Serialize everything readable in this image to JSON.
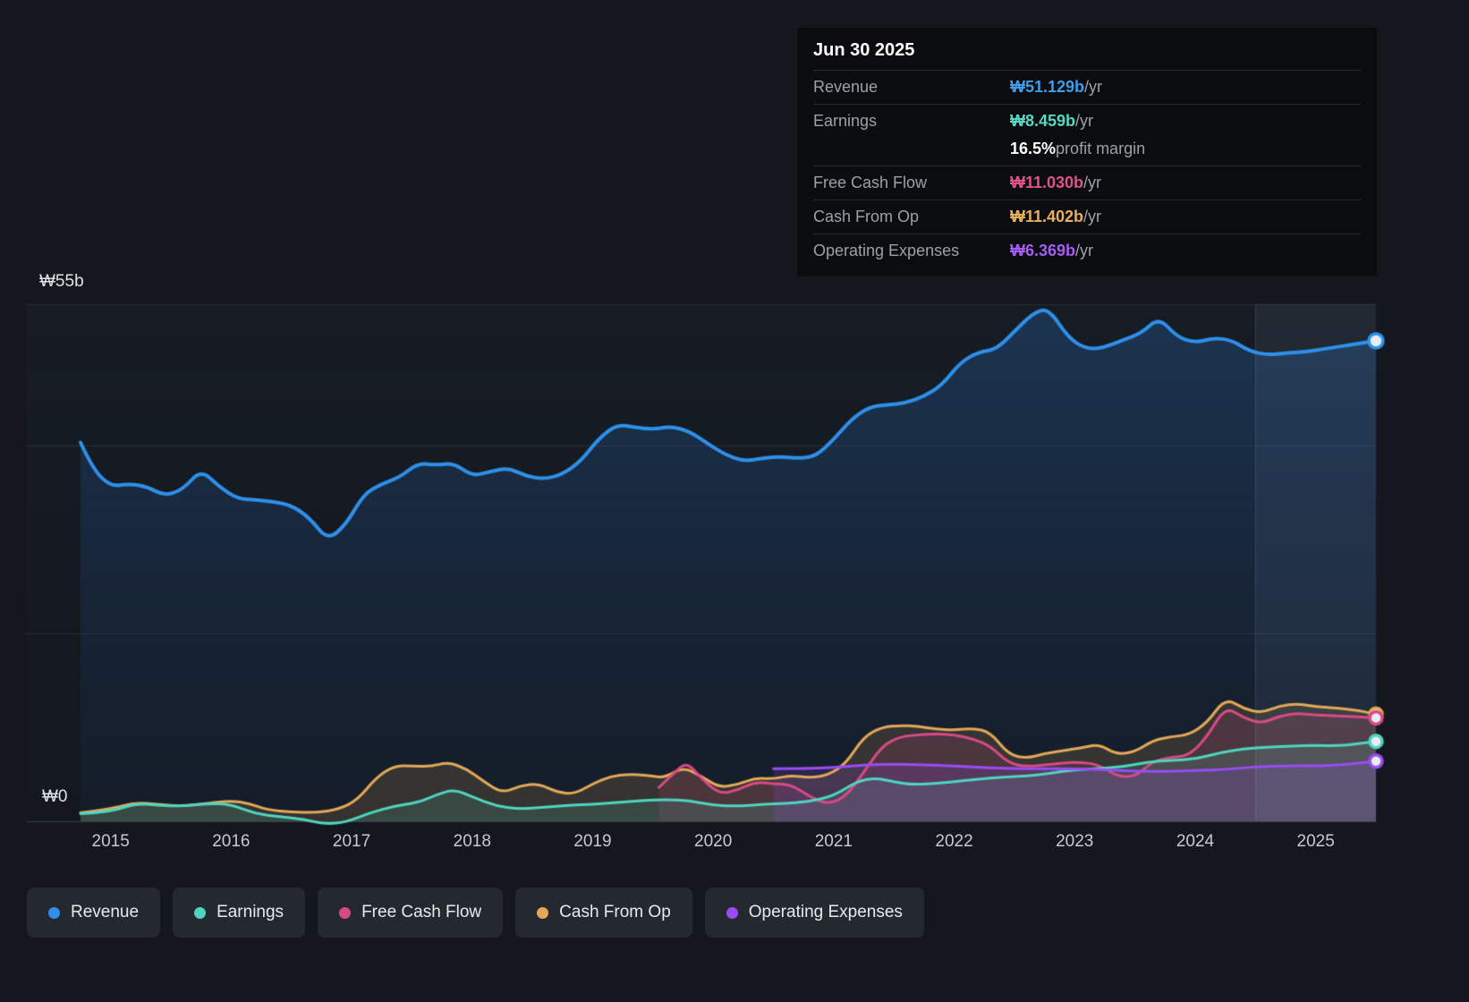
{
  "tooltip": {
    "date": "Jun 30 2025",
    "revenue": {
      "label": "Revenue",
      "value": "₩51.129b",
      "unit": " /yr",
      "color": "#3f9ceb"
    },
    "earnings": {
      "label": "Earnings",
      "value": "₩8.459b",
      "unit": " /yr",
      "color": "#56d8c5"
    },
    "margin": {
      "value": "16.5%",
      "text": " profit margin"
    },
    "fcf": {
      "label": "Free Cash Flow",
      "value": "₩11.030b",
      "unit": " /yr",
      "color": "#e0518e"
    },
    "cashop": {
      "label": "Cash From Op",
      "value": "₩11.402b",
      "unit": " /yr",
      "color": "#e7b05e"
    },
    "opex": {
      "label": "Operating Expenses",
      "value": "₩6.369b",
      "unit": " /yr",
      "color": "#a55cf5"
    }
  },
  "axis": {
    "y_top_label": "₩55b",
    "y_zero_label": "₩0",
    "years": [
      "2015",
      "2016",
      "2017",
      "2018",
      "2019",
      "2020",
      "2021",
      "2022",
      "2023",
      "2024",
      "2025"
    ]
  },
  "legend": {
    "items": [
      {
        "label": "Revenue",
        "color": "#2e90ea"
      },
      {
        "label": "Earnings",
        "color": "#4fd5bf"
      },
      {
        "label": "Free Cash Flow",
        "color": "#d84a85"
      },
      {
        "label": "Cash From Op",
        "color": "#e2a858"
      },
      {
        "label": "Operating Expenses",
        "color": "#9a4cf2"
      }
    ]
  },
  "chart_data": {
    "type": "area",
    "title": "Financial history: revenue, earnings, cash flows and operating expenses (₩ billions)",
    "x_domain": [
      2014.75,
      2025.5
    ],
    "ylim": [
      0,
      55
    ],
    "y_gridlines": [
      0,
      20,
      40,
      55
    ],
    "x_ticks": [
      2015,
      2016,
      2017,
      2018,
      2019,
      2020,
      2021,
      2022,
      2023,
      2024,
      2025
    ],
    "highlight_band": {
      "start": 2024.5,
      "end": 2025.5
    },
    "series": [
      {
        "name": "Revenue",
        "color": "#2e90ea",
        "line_width": 4,
        "fill_top": "rgba(40,110,185,0.30)",
        "fill_bottom": "rgba(30,70,130,0.10)",
        "fill": "rgba(40,110,185,0.22)",
        "points": [
          [
            2014.75,
            40.3
          ],
          [
            2014.85,
            37.5
          ],
          [
            2015.0,
            35.6
          ],
          [
            2015.15,
            35.9
          ],
          [
            2015.3,
            35.6
          ],
          [
            2015.45,
            34.6
          ],
          [
            2015.6,
            35.3
          ],
          [
            2015.75,
            37.4
          ],
          [
            2015.9,
            35.6
          ],
          [
            2016.05,
            34.3
          ],
          [
            2016.2,
            34.2
          ],
          [
            2016.35,
            34.0
          ],
          [
            2016.5,
            33.6
          ],
          [
            2016.65,
            32.3
          ],
          [
            2016.8,
            29.9
          ],
          [
            2016.95,
            31.5
          ],
          [
            2017.1,
            34.8
          ],
          [
            2017.25,
            35.9
          ],
          [
            2017.4,
            36.6
          ],
          [
            2017.55,
            38.1
          ],
          [
            2017.7,
            37.9
          ],
          [
            2017.85,
            38.1
          ],
          [
            2018.0,
            36.7
          ],
          [
            2018.15,
            37.2
          ],
          [
            2018.3,
            37.6
          ],
          [
            2018.45,
            36.7
          ],
          [
            2018.6,
            36.4
          ],
          [
            2018.75,
            36.9
          ],
          [
            2018.9,
            38.3
          ],
          [
            2019.05,
            40.7
          ],
          [
            2019.2,
            42.2
          ],
          [
            2019.35,
            41.9
          ],
          [
            2019.5,
            41.7
          ],
          [
            2019.65,
            42.0
          ],
          [
            2019.8,
            41.5
          ],
          [
            2019.95,
            40.2
          ],
          [
            2020.1,
            39.0
          ],
          [
            2020.25,
            38.3
          ],
          [
            2020.4,
            38.6
          ],
          [
            2020.55,
            38.8
          ],
          [
            2020.7,
            38.6
          ],
          [
            2020.85,
            38.8
          ],
          [
            2021.0,
            40.6
          ],
          [
            2021.15,
            42.8
          ],
          [
            2021.3,
            44.1
          ],
          [
            2021.45,
            44.3
          ],
          [
            2021.6,
            44.5
          ],
          [
            2021.75,
            45.2
          ],
          [
            2021.9,
            46.4
          ],
          [
            2022.05,
            48.8
          ],
          [
            2022.2,
            49.9
          ],
          [
            2022.35,
            50.2
          ],
          [
            2022.5,
            52.1
          ],
          [
            2022.65,
            54.0
          ],
          [
            2022.78,
            54.6
          ],
          [
            2022.95,
            51.4
          ],
          [
            2023.1,
            50.2
          ],
          [
            2023.25,
            50.4
          ],
          [
            2023.4,
            51.2
          ],
          [
            2023.55,
            51.9
          ],
          [
            2023.7,
            53.6
          ],
          [
            2023.85,
            51.5
          ],
          [
            2024.0,
            50.9
          ],
          [
            2024.15,
            51.4
          ],
          [
            2024.3,
            51.2
          ],
          [
            2024.45,
            50.0
          ],
          [
            2024.6,
            49.6
          ],
          [
            2024.75,
            49.8
          ],
          [
            2024.9,
            49.9
          ],
          [
            2025.05,
            50.2
          ],
          [
            2025.2,
            50.5
          ],
          [
            2025.35,
            50.8
          ],
          [
            2025.5,
            51.1
          ]
        ]
      },
      {
        "name": "Cash From Op",
        "color": "#e2a858",
        "line_width": 3,
        "fill": "rgba(226,168,88,0.16)",
        "points": [
          [
            2014.75,
            0.9
          ],
          [
            2015.0,
            1.3
          ],
          [
            2015.2,
            2.0
          ],
          [
            2015.4,
            1.8
          ],
          [
            2015.6,
            1.6
          ],
          [
            2015.8,
            1.9
          ],
          [
            2016.0,
            2.2
          ],
          [
            2016.15,
            1.9
          ],
          [
            2016.3,
            1.2
          ],
          [
            2016.5,
            1.0
          ],
          [
            2016.7,
            0.9
          ],
          [
            2016.9,
            1.3
          ],
          [
            2017.05,
            2.3
          ],
          [
            2017.2,
            4.6
          ],
          [
            2017.35,
            5.9
          ],
          [
            2017.5,
            5.9
          ],
          [
            2017.65,
            5.8
          ],
          [
            2017.8,
            6.3
          ],
          [
            2017.95,
            5.6
          ],
          [
            2018.1,
            4.2
          ],
          [
            2018.25,
            3.0
          ],
          [
            2018.4,
            3.8
          ],
          [
            2018.55,
            4.0
          ],
          [
            2018.7,
            3.1
          ],
          [
            2018.85,
            2.9
          ],
          [
            2019.0,
            4.0
          ],
          [
            2019.15,
            4.8
          ],
          [
            2019.3,
            5.0
          ],
          [
            2019.45,
            4.9
          ],
          [
            2019.6,
            4.6
          ],
          [
            2019.75,
            5.8
          ],
          [
            2019.9,
            4.8
          ],
          [
            2020.05,
            3.6
          ],
          [
            2020.2,
            3.9
          ],
          [
            2020.35,
            4.6
          ],
          [
            2020.5,
            4.5
          ],
          [
            2020.65,
            4.9
          ],
          [
            2020.8,
            4.6
          ],
          [
            2020.95,
            4.9
          ],
          [
            2021.1,
            6.1
          ],
          [
            2021.25,
            9.0
          ],
          [
            2021.4,
            10.0
          ],
          [
            2021.55,
            10.2
          ],
          [
            2021.7,
            10.1
          ],
          [
            2021.85,
            9.8
          ],
          [
            2022.0,
            9.7
          ],
          [
            2022.15,
            9.9
          ],
          [
            2022.3,
            9.5
          ],
          [
            2022.45,
            7.1
          ],
          [
            2022.6,
            6.7
          ],
          [
            2022.75,
            7.2
          ],
          [
            2022.9,
            7.5
          ],
          [
            2023.05,
            7.8
          ],
          [
            2023.2,
            8.2
          ],
          [
            2023.35,
            7.1
          ],
          [
            2023.5,
            7.4
          ],
          [
            2023.65,
            8.6
          ],
          [
            2023.8,
            9.0
          ],
          [
            2023.95,
            9.2
          ],
          [
            2024.1,
            10.5
          ],
          [
            2024.25,
            13.1
          ],
          [
            2024.4,
            12.0
          ],
          [
            2024.55,
            11.5
          ],
          [
            2024.7,
            12.3
          ],
          [
            2024.85,
            12.5
          ],
          [
            2025.0,
            12.2
          ],
          [
            2025.2,
            12.0
          ],
          [
            2025.35,
            11.8
          ],
          [
            2025.5,
            11.4
          ]
        ]
      },
      {
        "name": "Free Cash Flow",
        "color": "#d84a85",
        "line_width": 3,
        "fill": "rgba(214,73,132,0.14)",
        "points": [
          [
            2019.55,
            3.6
          ],
          [
            2019.68,
            5.2
          ],
          [
            2019.78,
            6.3
          ],
          [
            2019.9,
            4.6
          ],
          [
            2020.05,
            2.9
          ],
          [
            2020.2,
            3.3
          ],
          [
            2020.35,
            4.2
          ],
          [
            2020.5,
            4.0
          ],
          [
            2020.65,
            3.9
          ],
          [
            2020.8,
            2.6
          ],
          [
            2020.95,
            1.8
          ],
          [
            2021.1,
            2.6
          ],
          [
            2021.25,
            5.2
          ],
          [
            2021.4,
            8.0
          ],
          [
            2021.55,
            9.0
          ],
          [
            2021.7,
            9.2
          ],
          [
            2021.85,
            9.3
          ],
          [
            2022.0,
            9.2
          ],
          [
            2022.15,
            8.8
          ],
          [
            2022.3,
            8.0
          ],
          [
            2022.45,
            6.2
          ],
          [
            2022.6,
            5.8
          ],
          [
            2022.75,
            6.0
          ],
          [
            2022.9,
            6.2
          ],
          [
            2023.05,
            6.3
          ],
          [
            2023.2,
            6.0
          ],
          [
            2023.35,
            4.8
          ],
          [
            2023.5,
            4.7
          ],
          [
            2023.65,
            6.4
          ],
          [
            2023.8,
            6.8
          ],
          [
            2023.95,
            7.0
          ],
          [
            2024.1,
            9.0
          ],
          [
            2024.25,
            12.2
          ],
          [
            2024.4,
            11.0
          ],
          [
            2024.55,
            10.4
          ],
          [
            2024.7,
            11.2
          ],
          [
            2024.85,
            11.5
          ],
          [
            2025.0,
            11.3
          ],
          [
            2025.2,
            11.2
          ],
          [
            2025.5,
            11.0
          ]
        ]
      },
      {
        "name": "Earnings",
        "color": "#4fd5bf",
        "line_width": 3,
        "fill": "rgba(80,212,190,0.14)",
        "points": [
          [
            2014.75,
            0.8
          ],
          [
            2015.0,
            1.0
          ],
          [
            2015.2,
            1.9
          ],
          [
            2015.4,
            1.7
          ],
          [
            2015.6,
            1.6
          ],
          [
            2015.8,
            1.9
          ],
          [
            2016.0,
            1.8
          ],
          [
            2016.2,
            0.8
          ],
          [
            2016.4,
            0.5
          ],
          [
            2016.6,
            0.2
          ],
          [
            2016.78,
            -0.3
          ],
          [
            2016.95,
            -0.1
          ],
          [
            2017.15,
            0.9
          ],
          [
            2017.35,
            1.6
          ],
          [
            2017.55,
            2.0
          ],
          [
            2017.7,
            2.8
          ],
          [
            2017.85,
            3.4
          ],
          [
            2018.0,
            2.6
          ],
          [
            2018.2,
            1.6
          ],
          [
            2018.4,
            1.3
          ],
          [
            2018.6,
            1.5
          ],
          [
            2018.8,
            1.7
          ],
          [
            2019.0,
            1.8
          ],
          [
            2019.2,
            2.0
          ],
          [
            2019.4,
            2.2
          ],
          [
            2019.6,
            2.3
          ],
          [
            2019.8,
            2.2
          ],
          [
            2020.0,
            1.7
          ],
          [
            2020.2,
            1.6
          ],
          [
            2020.4,
            1.8
          ],
          [
            2020.6,
            1.9
          ],
          [
            2020.8,
            2.1
          ],
          [
            2021.0,
            2.7
          ],
          [
            2021.2,
            4.3
          ],
          [
            2021.35,
            4.6
          ],
          [
            2021.5,
            4.2
          ],
          [
            2021.65,
            3.9
          ],
          [
            2021.8,
            4.0
          ],
          [
            2022.0,
            4.2
          ],
          [
            2022.2,
            4.5
          ],
          [
            2022.4,
            4.7
          ],
          [
            2022.6,
            4.8
          ],
          [
            2022.8,
            5.1
          ],
          [
            2023.0,
            5.5
          ],
          [
            2023.2,
            5.6
          ],
          [
            2023.4,
            5.8
          ],
          [
            2023.6,
            6.3
          ],
          [
            2023.8,
            6.5
          ],
          [
            2024.0,
            6.6
          ],
          [
            2024.2,
            7.3
          ],
          [
            2024.4,
            7.7
          ],
          [
            2024.6,
            7.9
          ],
          [
            2024.8,
            8.0
          ],
          [
            2025.0,
            8.1
          ],
          [
            2025.2,
            8.0
          ],
          [
            2025.5,
            8.5
          ]
        ]
      },
      {
        "name": "Operating Expenses",
        "color": "#9a4cf2",
        "line_width": 3,
        "fill": "rgba(148,72,240,0.18)",
        "points": [
          [
            2020.5,
            5.6
          ],
          [
            2020.75,
            5.6
          ],
          [
            2021.0,
            5.7
          ],
          [
            2021.25,
            6.0
          ],
          [
            2021.5,
            6.1
          ],
          [
            2021.75,
            6.0
          ],
          [
            2022.0,
            5.9
          ],
          [
            2022.25,
            5.7
          ],
          [
            2022.5,
            5.6
          ],
          [
            2022.75,
            5.6
          ],
          [
            2023.0,
            5.6
          ],
          [
            2023.25,
            5.5
          ],
          [
            2023.5,
            5.3
          ],
          [
            2023.75,
            5.3
          ],
          [
            2024.0,
            5.4
          ],
          [
            2024.25,
            5.5
          ],
          [
            2024.5,
            5.8
          ],
          [
            2024.75,
            5.9
          ],
          [
            2025.0,
            5.9
          ],
          [
            2025.25,
            6.0
          ],
          [
            2025.5,
            6.4
          ]
        ]
      }
    ]
  }
}
